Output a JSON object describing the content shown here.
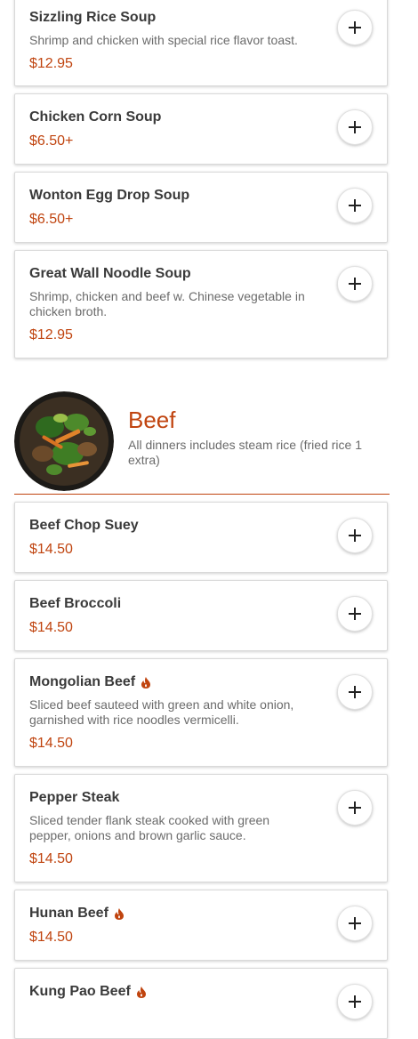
{
  "colors": {
    "accent": "#c0440f",
    "text": "#3a3a3a",
    "muted": "#6b6b6b"
  },
  "soups": [
    {
      "name": "Sizzling Rice Soup",
      "desc": "Shrimp and chicken with special rice flavor toast.",
      "price": "$12.95"
    },
    {
      "name": "Chicken Corn Soup",
      "desc": "",
      "price": "$6.50+"
    },
    {
      "name": "Wonton Egg Drop Soup",
      "desc": "",
      "price": "$6.50+"
    },
    {
      "name": "Great Wall Noodle Soup",
      "desc": "Shrimp, chicken and beef w. Chinese vegetable in chicken broth.",
      "price": "$12.95"
    }
  ],
  "beef_section": {
    "title": "Beef",
    "subtitle": "All dinners includes steam rice (fried rice 1 extra)"
  },
  "beef": [
    {
      "name": "Beef Chop Suey",
      "desc": "",
      "price": "$14.50",
      "spicy": false
    },
    {
      "name": "Beef Broccoli",
      "desc": "",
      "price": "$14.50",
      "spicy": false
    },
    {
      "name": "Mongolian Beef",
      "desc": "Sliced beef sauteed with green and white onion, garnished with rice noodles vermicelli.",
      "price": "$14.50",
      "spicy": true
    },
    {
      "name": "Pepper Steak",
      "desc": "Sliced tender flank steak cooked with green pepper, onions and brown garlic sauce.",
      "price": "$14.50",
      "spicy": false
    },
    {
      "name": "Hunan Beef",
      "desc": "",
      "price": "$14.50",
      "spicy": true
    },
    {
      "name": "Kung Pao Beef",
      "desc": "",
      "price": "",
      "spicy": true
    }
  ],
  "icons": {
    "add": "plus-icon",
    "spicy": "chili-icon"
  }
}
